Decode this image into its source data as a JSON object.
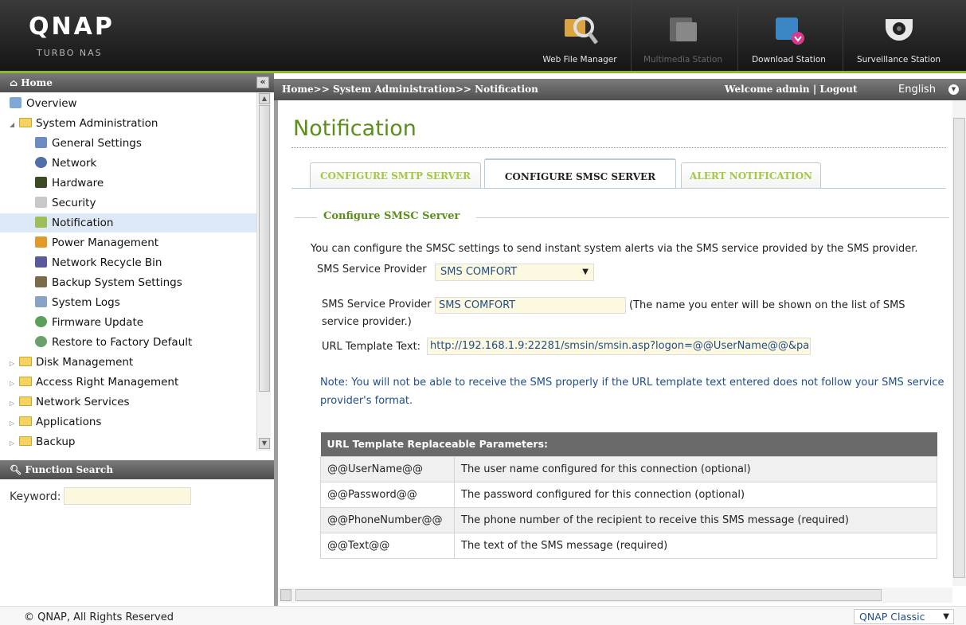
{
  "header": {
    "logo": "QNAP",
    "logo_sub": "TURBO NAS",
    "apps": [
      {
        "label": "Web File Manager"
      },
      {
        "label": "Multimedia Station"
      },
      {
        "label": "Download Station"
      },
      {
        "label": "Surveillance Station"
      }
    ]
  },
  "sidebar": {
    "home_label": "Home",
    "collapse": "«",
    "tree": [
      {
        "label": "Overview"
      },
      {
        "label": "System Administration"
      },
      {
        "label": "General Settings"
      },
      {
        "label": "Network"
      },
      {
        "label": "Hardware"
      },
      {
        "label": "Security"
      },
      {
        "label": "Notification"
      },
      {
        "label": "Power Management"
      },
      {
        "label": "Network Recycle Bin"
      },
      {
        "label": "Backup System Settings"
      },
      {
        "label": "System Logs"
      },
      {
        "label": "Firmware Update"
      },
      {
        "label": "Restore to Factory Default"
      },
      {
        "label": "Disk Management"
      },
      {
        "label": "Access Right Management"
      },
      {
        "label": "Network Services"
      },
      {
        "label": "Applications"
      },
      {
        "label": "Backup"
      }
    ],
    "function_search": "Function Search",
    "keyword_label": "Keyword:"
  },
  "topbar": {
    "breadcrumb": "Home>> System Administration>> Notification",
    "welcome": "Welcome admin | Logout",
    "language": "English"
  },
  "main": {
    "title": "Notification",
    "tabs": [
      "CONFIGURE SMTP SERVER",
      "CONFIGURE SMSC SERVER",
      "ALERT NOTIFICATION"
    ],
    "section_title": "Configure SMSC Server",
    "intro": "You can configure the SMSC settings to send instant system alerts via the SMS service provided by the SMS provider.",
    "provider_select_label": "SMS Service Provider",
    "provider_select_value": "SMS COMFORT",
    "provider_name_label": "SMS Service Provider",
    "provider_name_value": "SMS COMFORT",
    "provider_note_1": "(The name you enter will be shown on the list of SMS",
    "provider_note_2": "service provider.)",
    "url_label": "URL Template Text:",
    "url_value": "http://192.168.1.9:22281/smsin/smsin.asp?logon=@@UserName@@&pa",
    "note_1": "Note: You will not be able to receive the SMS properly if the URL template text entered does not follow your SMS service",
    "note_2": "provider's format.",
    "params_header": "URL Template Replaceable Parameters:",
    "params": [
      {
        "key": "@@UserName@@",
        "desc": "The user name configured for this connection (optional)"
      },
      {
        "key": "@@Password@@",
        "desc": "The password configured for this connection (optional)"
      },
      {
        "key": "@@PhoneNumber@@",
        "desc": "The phone number of the recipient to receive this SMS message (required)"
      },
      {
        "key": "@@Text@@",
        "desc": "The text of the SMS message (required)"
      }
    ]
  },
  "footer": {
    "copyright": "© QNAP, All Rights Reserved",
    "theme": "QNAP Classic"
  },
  "colors": {
    "accent_green": "#5b8e1a",
    "header_dark": "#1f1f1f",
    "link_blue": "#1f4e8c"
  }
}
